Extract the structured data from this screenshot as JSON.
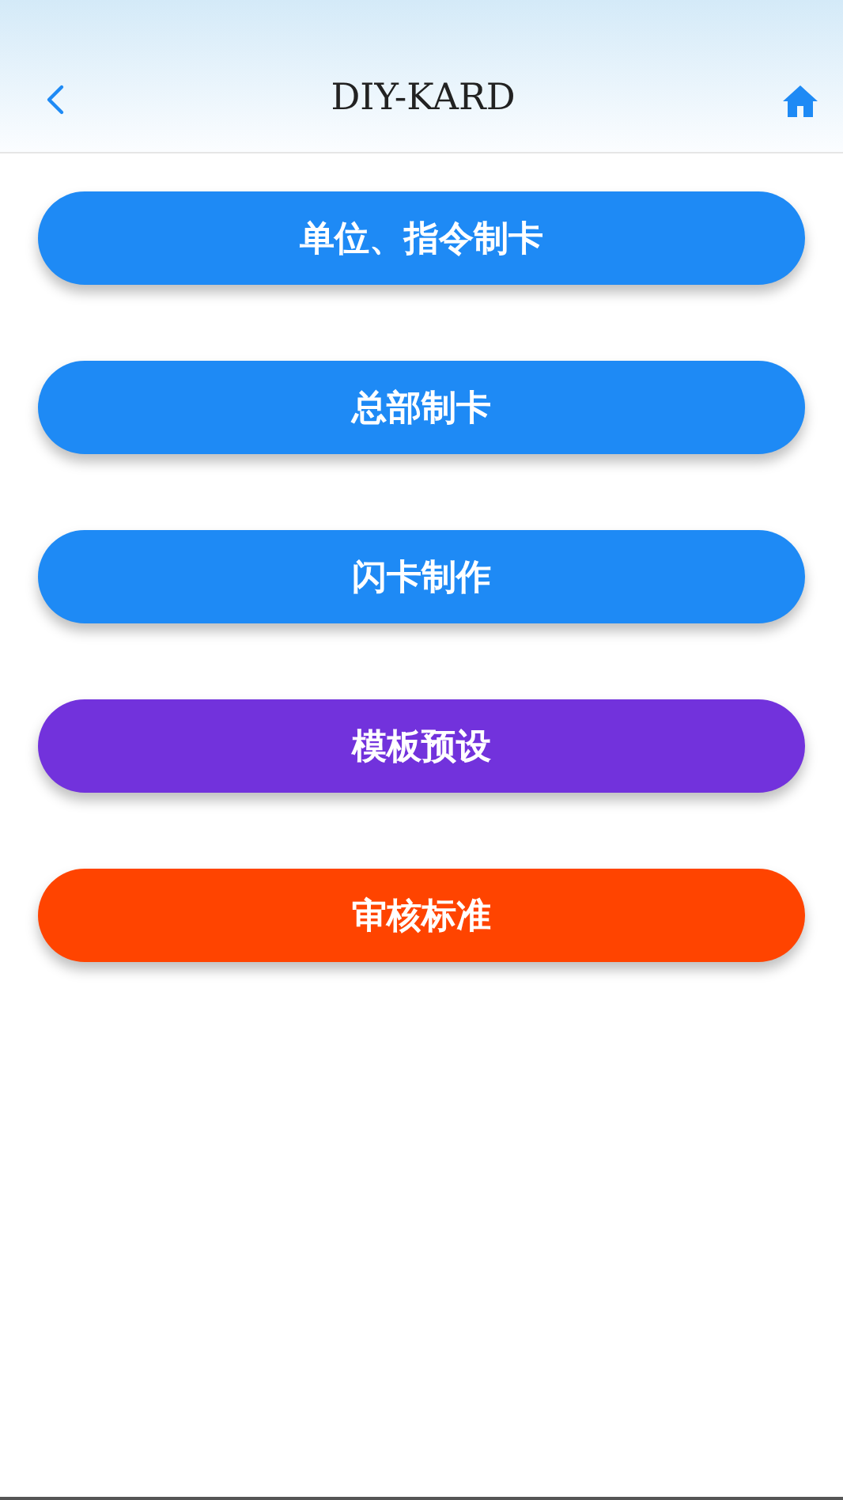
{
  "header": {
    "title": "DIY-KARD"
  },
  "buttons": [
    {
      "label": "单位、指令制卡",
      "color": "#1e8af5"
    },
    {
      "label": "总部制卡",
      "color": "#1e8af5"
    },
    {
      "label": "闪卡制作",
      "color": "#1e8af5"
    },
    {
      "label": "模板预设",
      "color": "#7232dc"
    },
    {
      "label": "审核标准",
      "color": "#ff4400"
    }
  ]
}
